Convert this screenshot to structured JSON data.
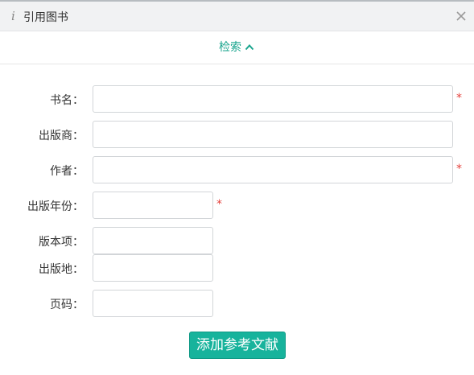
{
  "dialog": {
    "title_icon": "i",
    "title": "引用图书",
    "close_icon": "close-icon"
  },
  "search": {
    "label": "检索",
    "icon": "chevron-up-icon"
  },
  "form": {
    "fields": [
      {
        "label": "书名：",
        "value": "",
        "required": true,
        "required_mark": "*"
      },
      {
        "label": "出版商：",
        "value": "",
        "required": false
      },
      {
        "label": "作者：",
        "value": "",
        "required": true,
        "required_mark": "*"
      },
      {
        "label": "出版年份：",
        "value": "",
        "required": true,
        "required_mark": "*"
      },
      {
        "label": "版本项：",
        "value": "",
        "required": false
      },
      {
        "label": "出版地：",
        "value": "",
        "required": false
      },
      {
        "label": "页码：",
        "value": "",
        "required": false
      }
    ],
    "submit_label": "添加参考文献"
  },
  "colors": {
    "accent": "#17b39c",
    "required": "#e5413c",
    "link": "#1aa58e"
  }
}
